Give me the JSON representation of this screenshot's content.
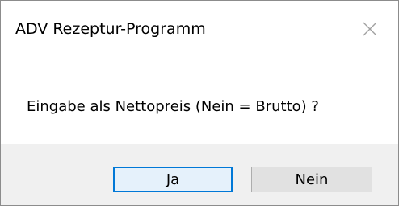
{
  "window": {
    "title": "ADV Rezeptur-Programm",
    "close_icon": "close-icon"
  },
  "message": {
    "text": "Eingabe als Nettopreis (Nein = Brutto) ?"
  },
  "buttons": {
    "yes_label": "Ja",
    "no_label": "Nein"
  },
  "colors": {
    "default_button_border": "#0078d7",
    "default_button_fill": "#e5f1fb",
    "button_fill": "#e1e1e1",
    "button_area": "#f0f0f0"
  }
}
